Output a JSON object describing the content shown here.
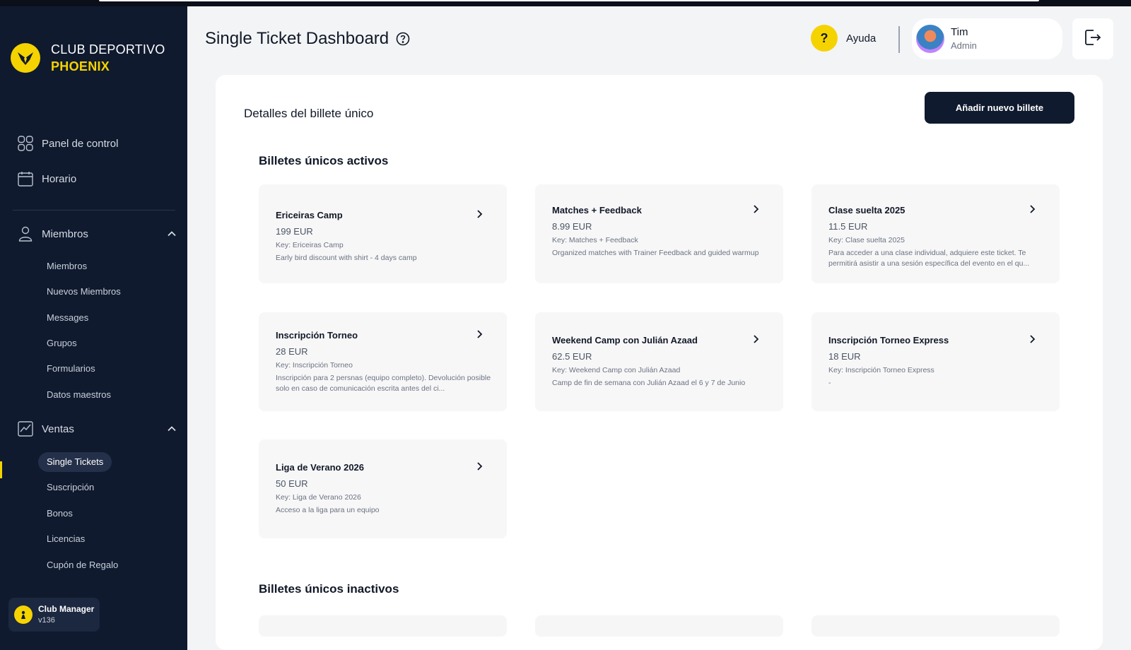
{
  "brand": {
    "line1": "CLUB DEPORTIVO",
    "line2": "PHOENIX",
    "accent_color": "#f5d300",
    "sidebar_color": "#0f1a2e"
  },
  "nav": {
    "dashboard": {
      "label": "Panel de control",
      "icon": "grid-icon"
    },
    "schedule": {
      "label": "Horario",
      "icon": "calendar-icon"
    },
    "members_section": {
      "label": "Miembros",
      "icon": "user-icon",
      "expanded": true,
      "items": [
        "Miembros",
        "Nuevos Miembros",
        "Messages",
        "Grupos",
        "Formularios",
        "Datos maestros"
      ]
    },
    "sales_section": {
      "label": "Ventas",
      "icon": "chart-icon",
      "expanded": true,
      "items": [
        "Single Tickets",
        "Suscripción",
        "Bonos",
        "Licencias",
        "Cupón de Regalo"
      ],
      "active_item": "Single Tickets"
    }
  },
  "club_manager": {
    "name": "Club Manager",
    "version": "v136"
  },
  "header": {
    "title": "Single Ticket Dashboard",
    "help_label": "Ayuda",
    "user": {
      "name": "Tim",
      "role": "Admin"
    }
  },
  "panel": {
    "title": "Detalles del billete único",
    "add_button": "Añadir nuevo billete",
    "active_title": "Billetes únicos activos",
    "inactive_title": "Billetes únicos inactivos",
    "active_tickets": [
      {
        "title": "Ericeiras Camp",
        "price": "199 EUR",
        "key": "Key: Ericeiras Camp",
        "desc": "Early bird discount with shirt - 4 days camp"
      },
      {
        "title": "Matches + Feedback",
        "price": "8.99 EUR",
        "key": "Key: Matches + Feedback",
        "desc": "Organized matches with Trainer Feedback and guided warmup"
      },
      {
        "title": "Clase suelta 2025",
        "price": "11.5 EUR",
        "key": "Key: Clase suelta 2025",
        "desc": "Para acceder a una clase individual, adquiere este ticket. Te permitirá asistir a una sesión específica del evento en el qu..."
      },
      {
        "title": "Inscripción Torneo",
        "price": "28 EUR",
        "key": "Key: Inscripción Torneo",
        "desc": "Inscripción para 2 persnas (equipo completo).  Devolución posible solo en caso de comunicación escrita antes del ci..."
      },
      {
        "title": "Weekend Camp con Julián Azaad",
        "price": "62.5 EUR",
        "key": "Key: Weekend Camp con Julián Azaad",
        "desc": "Camp de fin de semana con Julián Azaad el 6 y 7 de Junio"
      },
      {
        "title": "Inscripción Torneo Express",
        "price": "18 EUR",
        "key": "Key: Inscripción Torneo Express",
        "desc": "-"
      },
      {
        "title": "Liga de Verano 2026",
        "price": "50 EUR",
        "key": "Key: Liga de Verano 2026",
        "desc": "Acceso a la liga para un equipo"
      }
    ]
  }
}
